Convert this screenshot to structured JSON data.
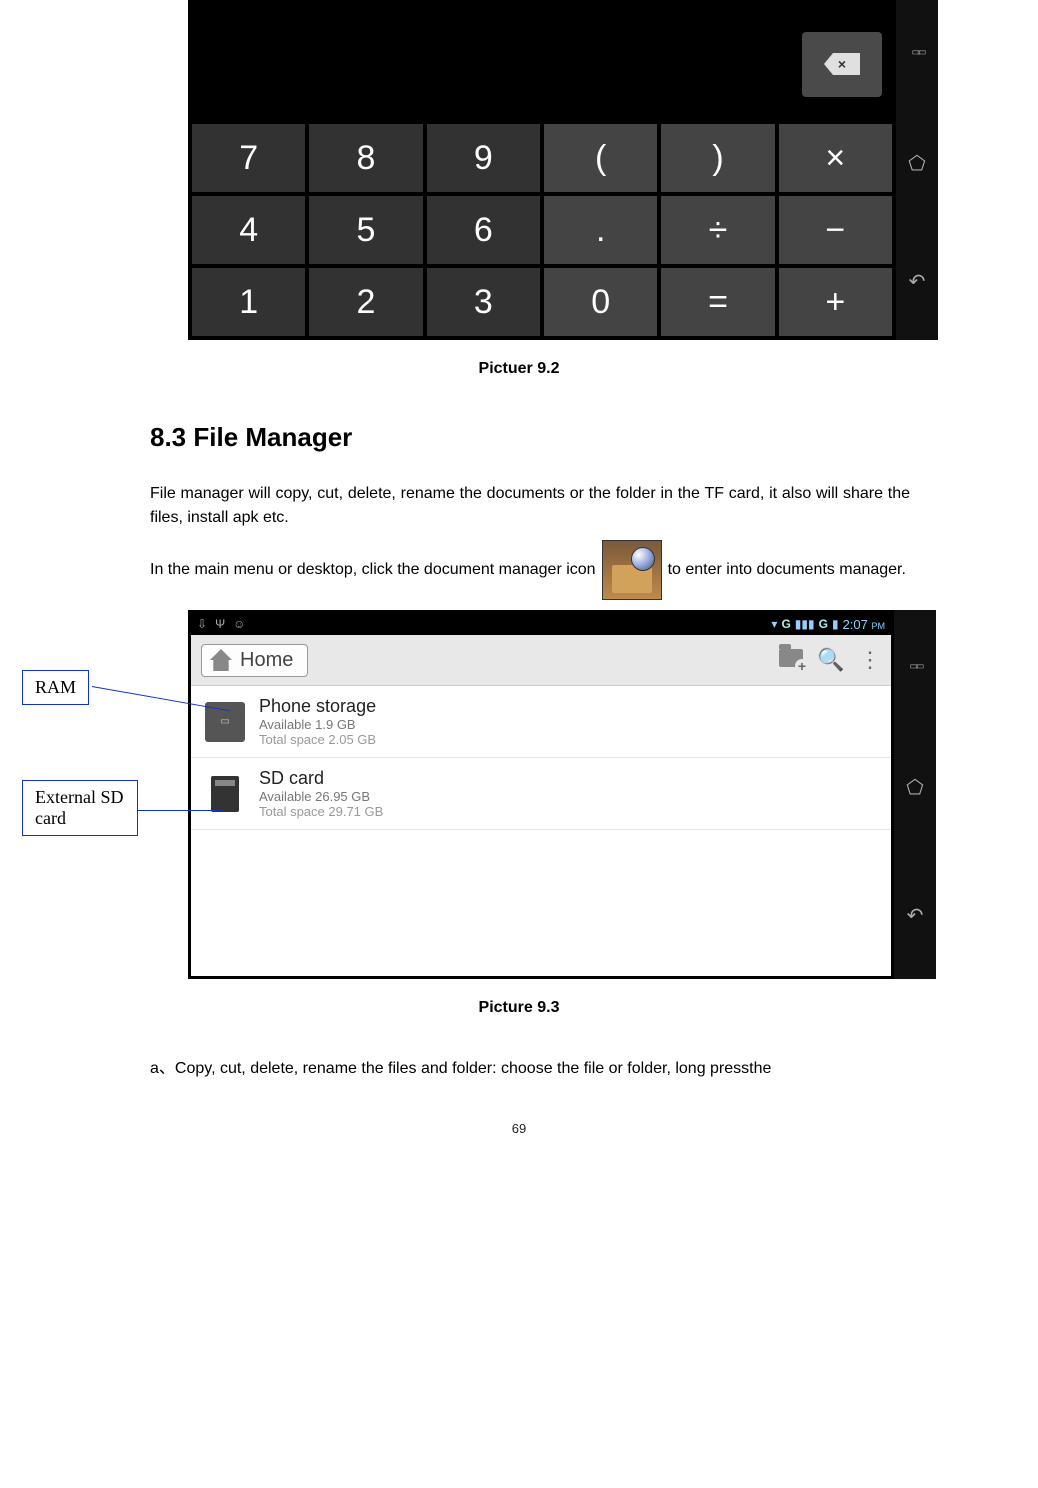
{
  "picture92": {
    "keypad": {
      "row1": [
        "7",
        "8",
        "9",
        "(",
        ")",
        "×"
      ],
      "row2": [
        "4",
        "5",
        "6",
        ".",
        "÷",
        "−"
      ],
      "row3": [
        "1",
        "2",
        "3",
        "0",
        "=",
        "+"
      ]
    },
    "caption": "Pictuer 9.2"
  },
  "section": {
    "heading": "8.3 File Manager",
    "para1": "File manager will copy, cut, delete, rename the documents or the folder in the TF card, it also will share the files, install apk etc.",
    "para2_before": "In the main menu or desktop, click the document manager icon",
    "para2_after": "to enter into documents manager.",
    "para3": "a、Copy, cut, delete, rename the files and folder: choose the file or folder, long pressthe"
  },
  "callouts": {
    "ram": "RAM",
    "sd": "External SD card"
  },
  "filemanager": {
    "status": {
      "left_icons": [
        "⇩",
        "Ψ",
        "☺"
      ],
      "signal": "▾",
      "g_label": "G",
      "bars": "▮▮▮",
      "battery": "▮",
      "time": "2:07",
      "ampm": "PM"
    },
    "header": {
      "home_label": "Home"
    },
    "rows": [
      {
        "title": "Phone storage",
        "available": "Available 1.9 GB",
        "total": "Total space 2.05 GB"
      },
      {
        "title": "SD card",
        "available": "Available 26.95 GB",
        "total": "Total space 29.71 GB"
      }
    ],
    "caption": "Picture 9.3"
  },
  "page_number": "69"
}
